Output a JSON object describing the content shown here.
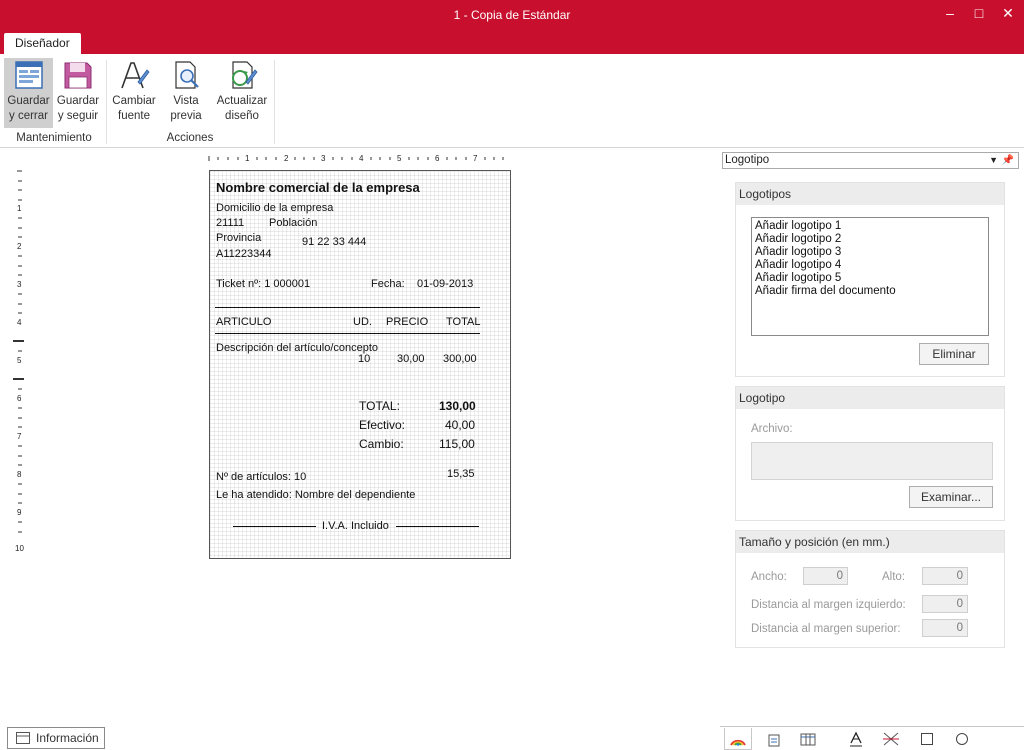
{
  "window": {
    "title": "1 - Copia de Estándar",
    "minimize_glyph": "–",
    "maximize_glyph": "□",
    "close_glyph": "✕"
  },
  "ribbon": {
    "tab": "Diseñador",
    "groups": {
      "mantenimiento": "Mantenimiento",
      "acciones": "Acciones"
    },
    "buttons": {
      "guardar_cerrar": [
        "Guardar",
        "y cerrar"
      ],
      "guardar_seguir": [
        "Guardar",
        "y seguir"
      ],
      "cambiar_fuente": [
        "Cambiar",
        "fuente"
      ],
      "vista_previa": [
        "Vista",
        "previa"
      ],
      "actualizar_diseno": [
        "Actualizar",
        "diseño"
      ]
    }
  },
  "rulers": {
    "horizontal": [
      "1",
      "2",
      "3",
      "4",
      "5",
      "6",
      "7"
    ],
    "vertical": [
      "1",
      "2",
      "3",
      "4",
      "5",
      "6",
      "7",
      "8",
      "9",
      "10"
    ]
  },
  "ticket": {
    "company": "Nombre  comercial de la empresa",
    "address": "Domicilio de la empresa",
    "postal_code": "21111",
    "city": "Población",
    "province": "Provincia",
    "phone": "91 22 33 444",
    "tax_id": "A11223344",
    "ticket_label": "Ticket nº:  1  000001",
    "date_label": "Fecha:",
    "date": "01-09-2013",
    "columns": {
      "article": "ARTICULO",
      "units": "UD.",
      "price": "PRECIO",
      "total": "TOTAL"
    },
    "item": {
      "description": "Descripción del artículo/concepto",
      "units": "10",
      "price": "30,00",
      "total": "300,00"
    },
    "totals": {
      "total_label": "TOTAL:",
      "total_value": "130,00",
      "cash_label": "Efectivo:",
      "cash_value": "40,00",
      "change_label": "Cambio:",
      "change_value": "115,00",
      "extra_value": "15,35"
    },
    "num_articles_label": "Nº de artículos:  10",
    "attended": "Le ha atendido:  Nombre del dependiente",
    "vat": "I.V.A. Incluido"
  },
  "panel": {
    "combo_value": "Logotipo",
    "logotipos": {
      "header": "Logotipos",
      "items": [
        "Añadir logotipo 1",
        "Añadir logotipo 2",
        "Añadir logotipo 3",
        "Añadir logotipo 4",
        "Añadir logotipo 5",
        "Añadir firma del documento"
      ],
      "delete_button": "Eliminar"
    },
    "logotipo": {
      "header": "Logotipo",
      "file_label": "Archivo:",
      "browse_button": "Examinar..."
    },
    "size": {
      "header": "Tamaño y posición (en mm.)",
      "width_label": "Ancho:",
      "width_value": "0",
      "height_label": "Alto:",
      "height_value": "0",
      "left_label": "Distancia al margen izquierdo:",
      "left_value": "0",
      "top_label": "Distancia al margen superior:",
      "top_value": "0"
    }
  },
  "status": {
    "info_tab": "Información"
  },
  "colors": {
    "brand": "#c8102e",
    "ribbon_active": "#cfcfcf",
    "section_header": "#ececec"
  }
}
